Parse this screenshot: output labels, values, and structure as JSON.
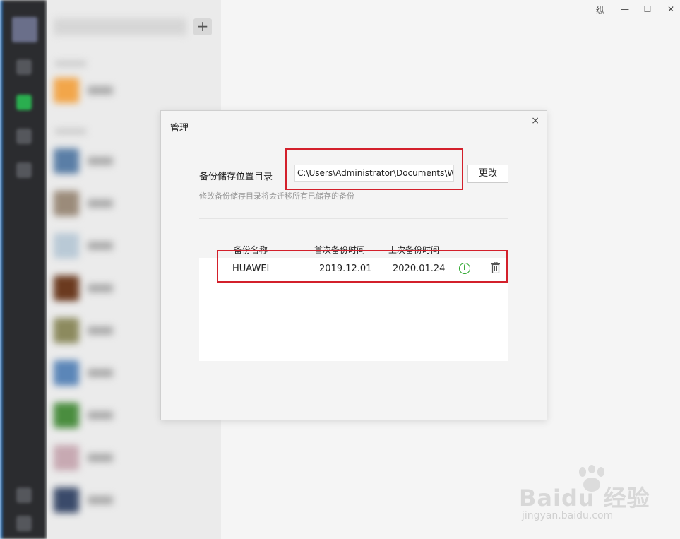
{
  "window_controls": {
    "pin": "纵",
    "minimize": "—",
    "maximize": "☐",
    "close": "✕"
  },
  "sidebar": {
    "add_label": "+"
  },
  "dialog": {
    "title": "管理",
    "close_label": "×",
    "dir_label": "备份储存位置目录",
    "dir_value": "C:\\Users\\Administrator\\Documents\\W",
    "change_button": "更改",
    "hint": "修改备份储存目录将会迁移所有已储存的备份",
    "table": {
      "headers": [
        "备份名称",
        "首次备份时间",
        "上次备份时间"
      ],
      "rows": [
        {
          "name": "HUAWEI",
          "first": "2019.12.01",
          "last": "2020.01.24",
          "info_icon": "info-icon",
          "delete_icon": "trash-icon"
        }
      ]
    }
  },
  "watermark": {
    "main": "Baidu 经验",
    "sub": "jingyan.baidu.com"
  },
  "colors": {
    "highlight": "#d3202b",
    "accent_green": "#2aa52a",
    "nav_bg": "#2b2c2f"
  }
}
